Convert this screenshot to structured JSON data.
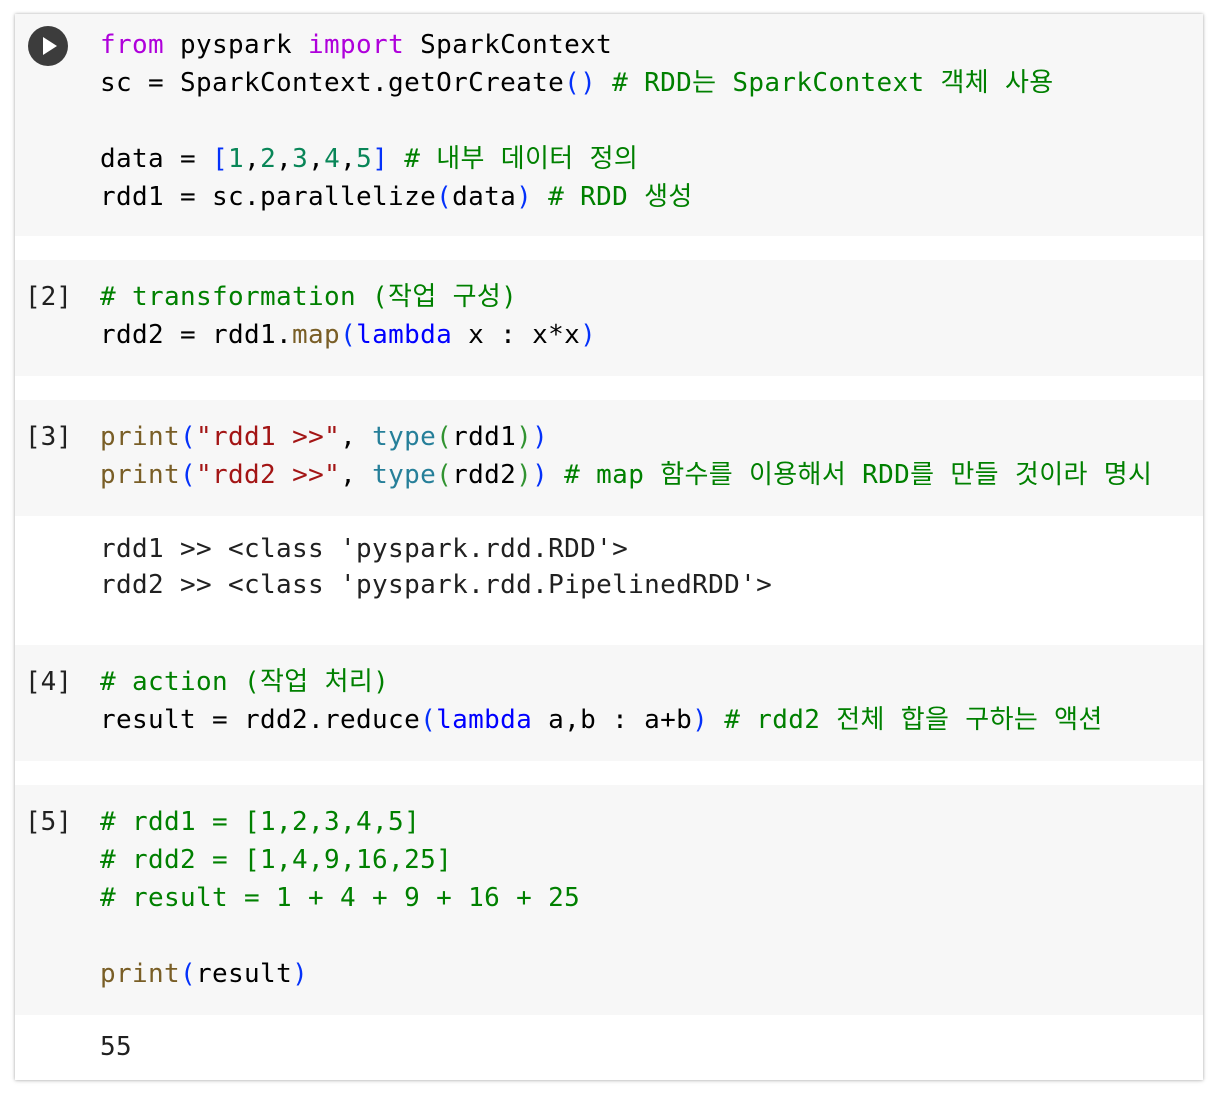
{
  "run_button": {
    "icon": "play-icon"
  },
  "cells": [
    {
      "prompt": "",
      "lines": [
        [
          {
            "t": "from",
            "c": "kw"
          },
          {
            "t": " pyspark ",
            "c": ""
          },
          {
            "t": "import",
            "c": "kw"
          },
          {
            "t": " SparkContext",
            "c": ""
          }
        ],
        [
          {
            "t": "sc = SparkContext.getOrCreate",
            "c": ""
          },
          {
            "t": "()",
            "c": "b1"
          },
          {
            "t": " # RDD는 SparkContext 객체 사용",
            "c": "cm"
          }
        ],
        [],
        [
          {
            "t": "data = ",
            "c": ""
          },
          {
            "t": "[",
            "c": "b1"
          },
          {
            "t": "1",
            "c": "num"
          },
          {
            "t": ",",
            "c": ""
          },
          {
            "t": "2",
            "c": "num"
          },
          {
            "t": ",",
            "c": ""
          },
          {
            "t": "3",
            "c": "num"
          },
          {
            "t": ",",
            "c": ""
          },
          {
            "t": "4",
            "c": "num"
          },
          {
            "t": ",",
            "c": ""
          },
          {
            "t": "5",
            "c": "num"
          },
          {
            "t": "]",
            "c": "b1"
          },
          {
            "t": " # 내부 데이터 정의",
            "c": "cm"
          }
        ],
        [
          {
            "t": "rdd1 = sc.parallelize",
            "c": ""
          },
          {
            "t": "(",
            "c": "b1"
          },
          {
            "t": "data",
            "c": ""
          },
          {
            "t": ")",
            "c": "b1"
          },
          {
            "t": " # RDD 생성",
            "c": "cm"
          }
        ]
      ],
      "output": []
    },
    {
      "prompt": "[2]",
      "lines": [
        [
          {
            "t": "# transformation (작업 구성)",
            "c": "cm"
          }
        ],
        [
          {
            "t": "rdd2 = rdd1.",
            "c": ""
          },
          {
            "t": "map",
            "c": "fn"
          },
          {
            "t": "(",
            "c": "b1"
          },
          {
            "t": "lambda",
            "c": "kw2"
          },
          {
            "t": " x : x*x",
            "c": ""
          },
          {
            "t": ")",
            "c": "b1"
          }
        ]
      ],
      "output": []
    },
    {
      "prompt": "[3]",
      "lines": [
        [
          {
            "t": "print",
            "c": "fn"
          },
          {
            "t": "(",
            "c": "b1"
          },
          {
            "t": "\"rdd1 >>\"",
            "c": "str"
          },
          {
            "t": ", ",
            "c": ""
          },
          {
            "t": "type",
            "c": "bi"
          },
          {
            "t": "(",
            "c": "b2"
          },
          {
            "t": "rdd1",
            "c": ""
          },
          {
            "t": ")",
            "c": "b2"
          },
          {
            "t": ")",
            "c": "b1"
          }
        ],
        [
          {
            "t": "print",
            "c": "fn"
          },
          {
            "t": "(",
            "c": "b1"
          },
          {
            "t": "\"rdd2 >>\"",
            "c": "str"
          },
          {
            "t": ", ",
            "c": ""
          },
          {
            "t": "type",
            "c": "bi"
          },
          {
            "t": "(",
            "c": "b2"
          },
          {
            "t": "rdd2",
            "c": ""
          },
          {
            "t": ")",
            "c": "b2"
          },
          {
            "t": ")",
            "c": "b1"
          },
          {
            "t": " # map 함수를 이용해서 RDD를 만들 것이라 명시",
            "c": "cm"
          }
        ]
      ],
      "output": [
        "rdd1 >> <class 'pyspark.rdd.RDD'>",
        "rdd2 >> <class 'pyspark.rdd.PipelinedRDD'>"
      ]
    },
    {
      "prompt": "[4]",
      "lines": [
        [
          {
            "t": "# action (작업 처리)",
            "c": "cm"
          }
        ],
        [
          {
            "t": "result = rdd2.reduce",
            "c": ""
          },
          {
            "t": "(",
            "c": "b1"
          },
          {
            "t": "lambda",
            "c": "kw2"
          },
          {
            "t": " a,b : a+b",
            "c": ""
          },
          {
            "t": ")",
            "c": "b1"
          },
          {
            "t": " # rdd2 전체 합을 구하는 액션",
            "c": "cm"
          }
        ]
      ],
      "output": []
    },
    {
      "prompt": "[5]",
      "lines": [
        [
          {
            "t": "# rdd1 = [1,2,3,4,5]",
            "c": "cm"
          }
        ],
        [
          {
            "t": "# rdd2 = [1,4,9,16,25]",
            "c": "cm"
          }
        ],
        [
          {
            "t": "# result = 1 + 4 + 9 + 16 + 25",
            "c": "cm"
          }
        ],
        [],
        [
          {
            "t": "print",
            "c": "fn"
          },
          {
            "t": "(",
            "c": "b1"
          },
          {
            "t": "result",
            "c": ""
          },
          {
            "t": ")",
            "c": "b1"
          }
        ]
      ],
      "output": [
        "55"
      ]
    }
  ]
}
